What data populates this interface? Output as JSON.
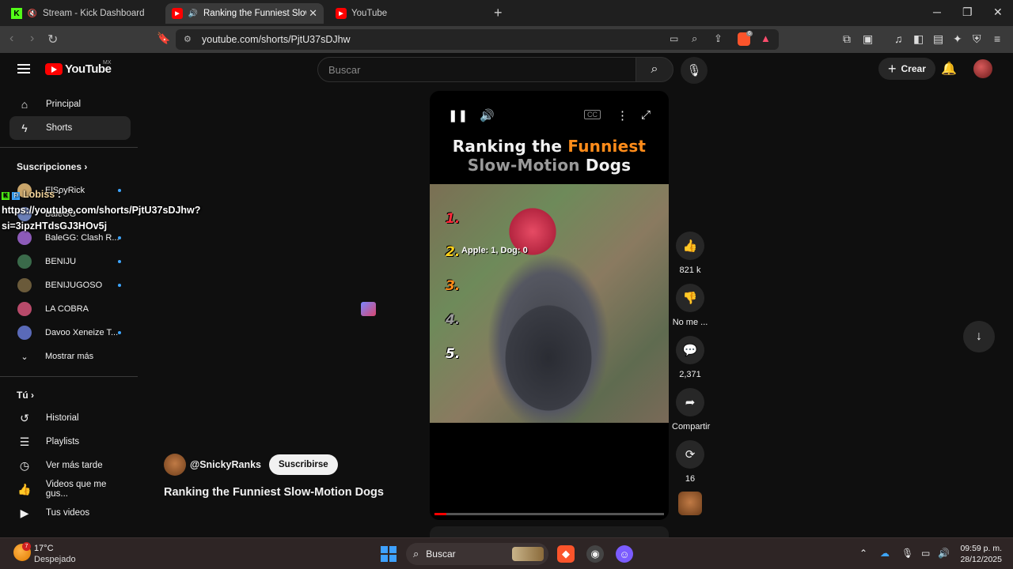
{
  "browser": {
    "tabs": [
      {
        "title": "Stream - Kick Dashboard",
        "active": false
      },
      {
        "title": "Ranking the Funniest Slow-M",
        "active": true
      },
      {
        "title": "YouTube",
        "active": false
      }
    ],
    "url": "youtube.com/shorts/PjtU37sDJhw",
    "brave_badge": "6"
  },
  "header": {
    "logo": "YouTube",
    "country": "MX",
    "search_placeholder": "Buscar",
    "create_label": "Crear"
  },
  "sidebar": {
    "main": [
      {
        "label": "Principal",
        "icon": "home-icon"
      },
      {
        "label": "Shorts",
        "icon": "shorts-icon",
        "selected": true
      }
    ],
    "subscriptions_title": "Suscripciones",
    "subscriptions": [
      {
        "label": "ElSoyRick",
        "color": "#c9a56a"
      },
      {
        "label": "BaleGG",
        "color": "#6a7fb8"
      },
      {
        "label": "BaleGG: Clash R...",
        "color": "#8c5ab8"
      },
      {
        "label": "BENIJU",
        "color": "#3a6a4a"
      },
      {
        "label": "BENIJUGOSO",
        "color": "#6a5a3a"
      },
      {
        "label": "LA COBRA",
        "color": "#b84a6a"
      },
      {
        "label": "Davoo Xeneize T...",
        "color": "#5a6ab8"
      }
    ],
    "more_label": "Mostrar más",
    "you_title": "Tú",
    "you": [
      {
        "label": "Historial",
        "icon": "history-icon"
      },
      {
        "label": "Playlists",
        "icon": "playlist-icon"
      },
      {
        "label": "Ver más tarde",
        "icon": "clock-icon"
      },
      {
        "label": "Videos que me gus...",
        "icon": "thumbs-up-icon"
      },
      {
        "label": "Tus videos",
        "icon": "video-icon"
      }
    ]
  },
  "overlay": {
    "user": "Lobiss",
    "line1": "https://youtube.com/shorts/PjtU37sDJhw?",
    "line2": "si=3ipzHTdsGJ3HOv5j"
  },
  "short": {
    "title_line1_a": "Ranking the",
    "title_line1_b": "Funniest",
    "title_line2_a": "Slow-Motion",
    "title_line2_b": "Dogs",
    "ranks": [
      "1.",
      "2.",
      "3.",
      "4.",
      "5."
    ],
    "caption": "Apple: 1, Dog: 0",
    "progress": 0.05,
    "channel": "@SnickyRanks",
    "subscribe_label": "Suscribirse",
    "video_title": "Ranking the Funniest Slow-Motion Dogs"
  },
  "actions": {
    "likes": "821 k",
    "dislike_label": "No me ...",
    "comments": "2,371",
    "share_label": "Compartir",
    "remix": "16"
  },
  "taskbar": {
    "weather_temp": "17°C",
    "weather_desc": "Despejado",
    "weather_badge": "7",
    "search_label": "Buscar",
    "time": "09:59 p. m.",
    "date": "28/12/2025"
  }
}
